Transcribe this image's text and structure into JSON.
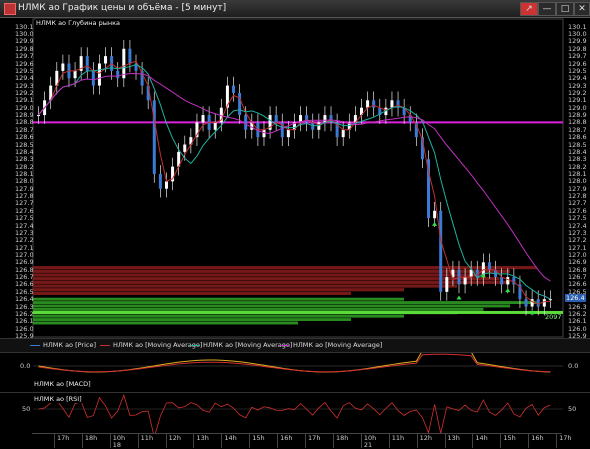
{
  "window": {
    "title": "НЛМК ао График цены и объёма - [5 минут]",
    "buttons": [
      "↗",
      "—",
      "□",
      "✕"
    ],
    "accent": "#d33"
  },
  "main_chart": {
    "caption": "НЛМК ао  Глубина рынка",
    "y_ticks": [
      "130.1",
      "130.0",
      "129.9",
      "129.8",
      "129.7",
      "129.6",
      "129.5",
      "129.4",
      "129.3",
      "129.2",
      "129.1",
      "129.0",
      "128.9",
      "128.8",
      "128.7",
      "128.6",
      "128.5",
      "128.4",
      "128.3",
      "128.2",
      "128.1",
      "128.0",
      "127.9",
      "127.8",
      "127.7",
      "127.6",
      "127.5",
      "127.4",
      "127.3",
      "127.2",
      "127.1",
      "127.0",
      "126.9",
      "126.8",
      "126.7",
      "126.6",
      "126.5",
      "126.4",
      "126.3",
      "126.2",
      "126.1",
      "126.0",
      "125.9"
    ],
    "last_price": "126.4",
    "depth_value": "2097",
    "level_line": "128.8"
  },
  "legend": [
    {
      "label": "НЛМК ао [Price]",
      "color": "#3a7bd5"
    },
    {
      "label": "НЛМК ао [Moving Average]",
      "color": "#c03030"
    },
    {
      "label": "НЛМК ао [Moving Average]",
      "color": "#20b0a0"
    },
    {
      "label": "НЛМК ао [Moving Average]",
      "color": "#c030c0"
    }
  ],
  "macd_panel": {
    "caption": "НЛМК ао [MACD]",
    "y_ticks": [
      "0.0"
    ]
  },
  "rsi_panel": {
    "caption": "НЛМК ао [RSI]",
    "y_ticks": [
      "50"
    ]
  },
  "time_axis": {
    "hours": [
      "17h",
      "18h",
      "10h",
      "11h",
      "12h",
      "13h",
      "14h",
      "15h",
      "16h",
      "17h",
      "18h",
      "10h",
      "11h",
      "12h",
      "13h",
      "14h",
      "15h",
      "16h",
      "17h"
    ],
    "days": [
      "18",
      "21"
    ]
  },
  "chart_data": {
    "type": "candlestick",
    "ylim": [
      125.9,
      130.15
    ],
    "candles_close": [
      128.9,
      129.1,
      129.3,
      129.5,
      129.6,
      129.4,
      129.5,
      129.7,
      129.5,
      129.3,
      129.6,
      129.7,
      129.5,
      129.4,
      129.8,
      129.6,
      129.5,
      129.3,
      129.1,
      128.1,
      127.9,
      128.0,
      128.2,
      128.4,
      128.5,
      128.6,
      128.8,
      128.9,
      128.7,
      128.8,
      129.0,
      129.3,
      129.2,
      128.9,
      128.7,
      128.8,
      128.6,
      128.7,
      128.9,
      128.8,
      128.6,
      128.7,
      128.8,
      128.9,
      128.8,
      128.7,
      128.8,
      128.9,
      128.8,
      128.6,
      128.7,
      128.8,
      128.9,
      129.0,
      129.1,
      129.0,
      128.9,
      129.0,
      129.1,
      129.0,
      128.9,
      128.8,
      128.6,
      128.3,
      127.5,
      127.6,
      126.5,
      126.7,
      126.8,
      126.6,
      126.7,
      126.8,
      126.7,
      126.9,
      126.8,
      126.7,
      126.6,
      126.7,
      126.6,
      126.4,
      126.3,
      126.4,
      126.3,
      126.4,
      126.4
    ],
    "depth_asks": [
      0.95,
      0.9,
      0.85,
      0.88,
      0.9,
      0.8,
      0.7,
      0.6
    ],
    "depth_bids": [
      0.7,
      0.95,
      0.9,
      0.85,
      0.8,
      0.7,
      0.6,
      0.5
    ]
  }
}
